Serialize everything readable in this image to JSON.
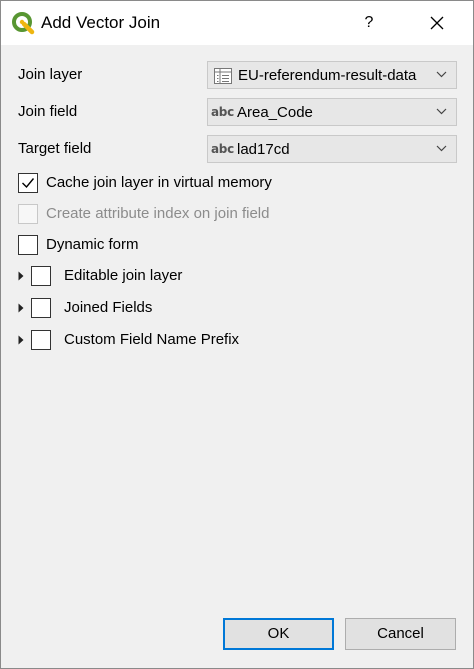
{
  "window": {
    "title": "Add Vector Join",
    "help_label": "?"
  },
  "form": {
    "join_layer": {
      "label": "Join layer",
      "value": "EU-referendum-result-data",
      "icon": "table-layer-icon"
    },
    "join_field": {
      "label": "Join field",
      "type_badge": "abc",
      "value": "Area_Code"
    },
    "target_field": {
      "label": "Target field",
      "type_badge": "abc",
      "value": "lad17cd"
    }
  },
  "options": {
    "cache": {
      "label": "Cache join layer in virtual memory",
      "checked": true,
      "enabled": true
    },
    "attr_index": {
      "label": "Create attribute index on join field",
      "checked": false,
      "enabled": false
    },
    "dynamic_form": {
      "label": "Dynamic form",
      "checked": false,
      "enabled": true
    }
  },
  "groups": {
    "editable": {
      "label": "Editable join layer",
      "checked": false,
      "expanded": false
    },
    "joined_fields": {
      "label": "Joined Fields",
      "checked": false,
      "expanded": false
    },
    "prefix": {
      "label": "Custom Field Name Prefix",
      "checked": false,
      "expanded": false
    }
  },
  "buttons": {
    "ok": "OK",
    "cancel": "Cancel"
  },
  "colors": {
    "qgis_green": "#589632",
    "qgis_yellow": "#eeb611",
    "accent": "#0078d7"
  }
}
